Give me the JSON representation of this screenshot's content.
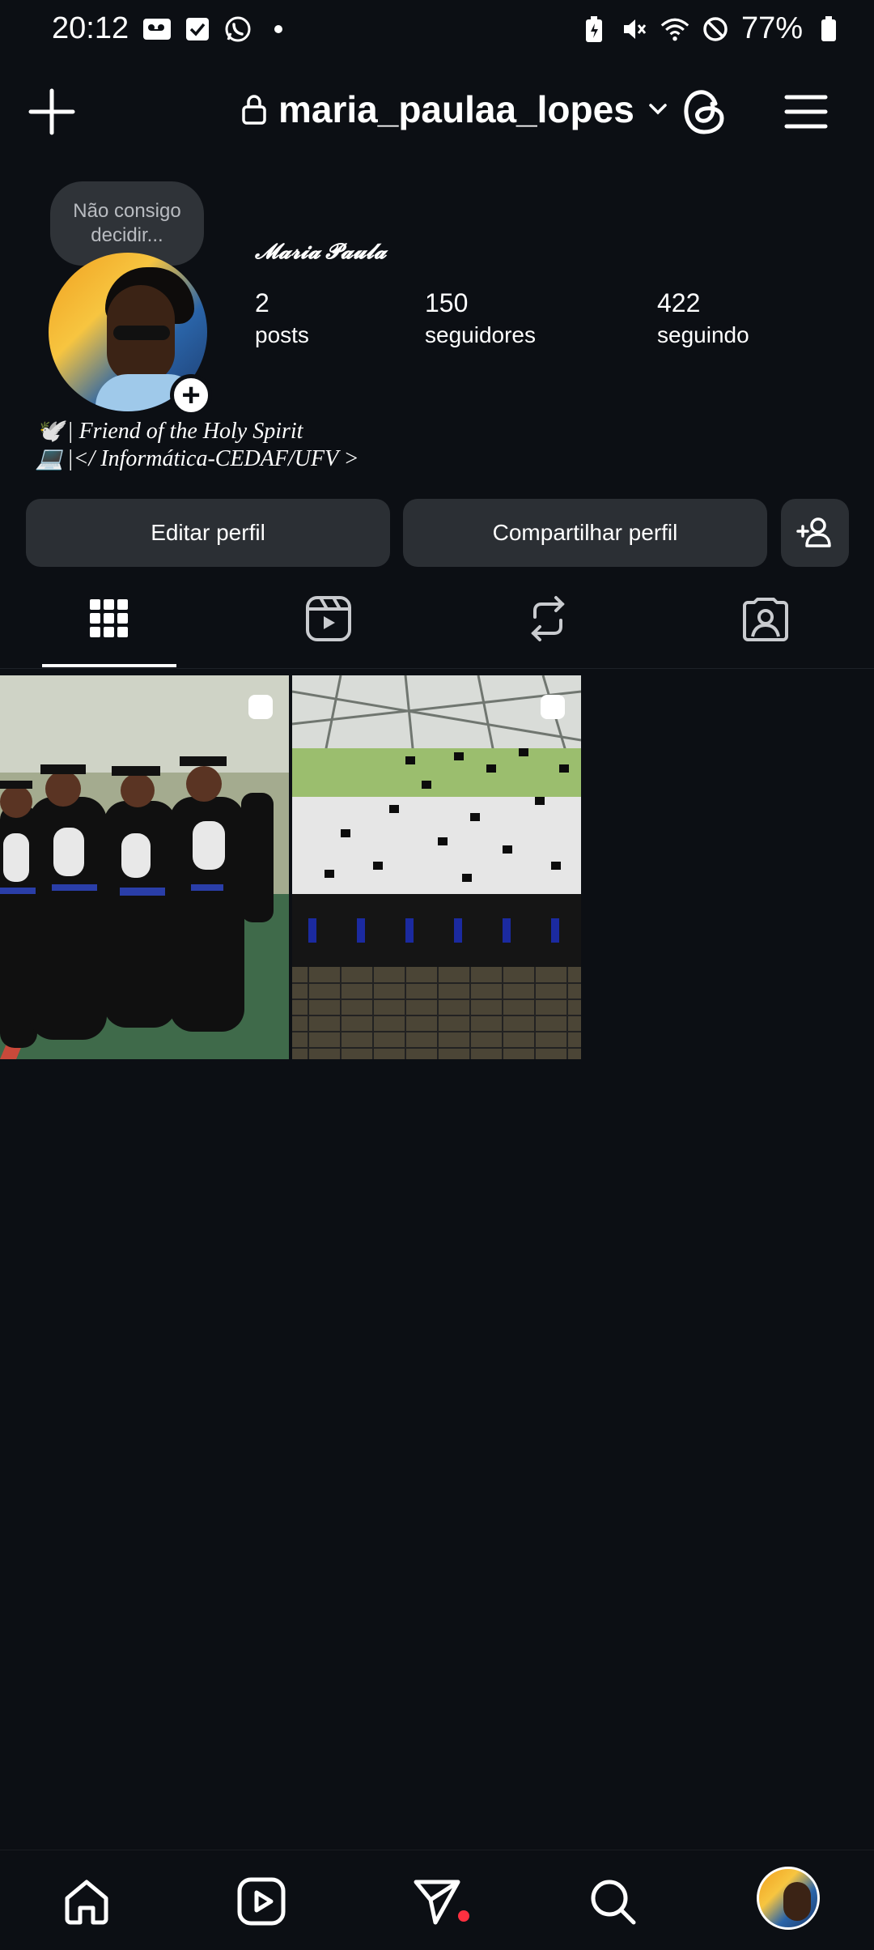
{
  "status_bar": {
    "time": "20:12",
    "battery": "77%",
    "left_icons": [
      "voicemail-icon",
      "checkbox-icon",
      "whatsapp-icon",
      "dot-icon"
    ],
    "right_icons": [
      "battery-saver-icon",
      "mute-icon",
      "wifi-icon",
      "do-not-disturb-icon",
      "battery-icon"
    ]
  },
  "header": {
    "username": "maria_paulaa_lopes"
  },
  "profile": {
    "note": "Não consigo decidir...",
    "display_name": "𝓜𝓪𝓻𝓲𝓪 𝓟𝓪𝓾𝓵𝓪",
    "stats": [
      {
        "value": "2",
        "label": "posts"
      },
      {
        "value": "150",
        "label": "seguidores"
      },
      {
        "value": "422",
        "label": "seguindo"
      }
    ],
    "bio": [
      {
        "emoji": "🕊️",
        "text": "| Friend of the Holy Spirit"
      },
      {
        "emoji": "💻",
        "text": "|</ Informática-CEDAF/UFV >"
      }
    ]
  },
  "actions": {
    "edit": "Editar perfil",
    "share": "Compartilhar perfil"
  },
  "tabs": [
    "grid",
    "reels",
    "reposts",
    "tagged"
  ],
  "posts": [
    {
      "description": "graduates-in-gowns",
      "multi": true
    },
    {
      "description": "graduation-caps-thrown",
      "multi": true
    }
  ],
  "colors": {
    "background": "#0c0f14",
    "button": "#2b2f34",
    "notification": "#ff3040"
  }
}
